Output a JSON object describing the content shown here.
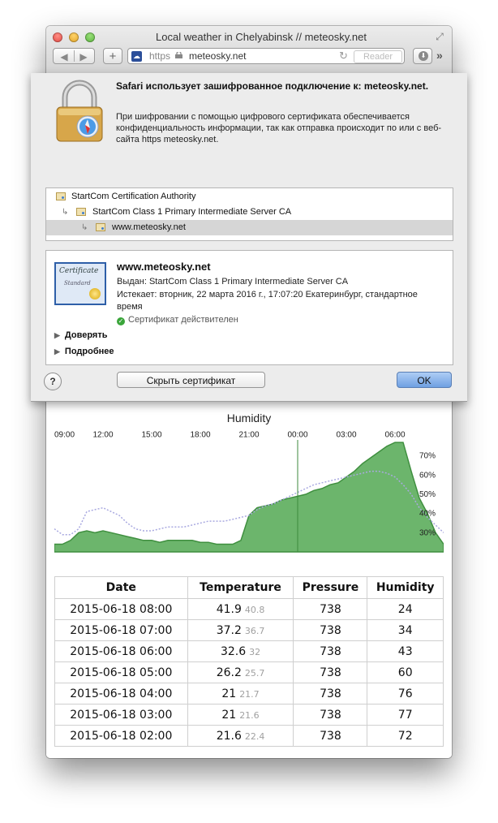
{
  "window": {
    "title": "Local weather in Chelyabinsk // meteosky.net"
  },
  "toolbar": {
    "back": "◀",
    "forward": "▶",
    "add": "+",
    "scheme": "https",
    "host": "meteosky.net",
    "reload": "↻",
    "reader": "Reader",
    "download": "⬇",
    "more": "»"
  },
  "sheet": {
    "heading": "Safari использует зашифрованное подключение к: meteosky.net.",
    "description": "При шифровании с помощью цифрового сертификата обеспечивается конфиденциальность информации, так как отправка происходит по или с веб-сайта https meteosky.net.",
    "chain": [
      {
        "label": "StartCom Certification Authority"
      },
      {
        "label": "StartCom Class 1 Primary Intermediate Server CA"
      },
      {
        "label": "www.meteosky.net"
      }
    ],
    "cert": {
      "name": "www.meteosky.net",
      "issued": "Выдан: StartCom Class 1 Primary Intermediate Server CA",
      "expires": "Истекает: вторник, 22 марта 2016 г., 17:07:20 Екатеринбург, стандартное время",
      "valid": "Сертификат действителен",
      "image_word1": "Certificate",
      "image_word2": "Standard"
    },
    "trust_label": "Доверять",
    "details_label": "Подробнее",
    "help": "?",
    "hide_button": "Скрыть сертификат",
    "ok_button": "OK"
  },
  "page": {
    "chart_title": "Humidity",
    "table": {
      "headers": [
        "Date",
        "Temperature",
        "Pressure",
        "Humidity"
      ],
      "rows": [
        {
          "date": "2015-06-18 08:00",
          "temp": "41.9",
          "temp2": "40.8",
          "pressure": "738",
          "humidity": "24"
        },
        {
          "date": "2015-06-18 07:00",
          "temp": "37.2",
          "temp2": "36.7",
          "pressure": "738",
          "humidity": "34"
        },
        {
          "date": "2015-06-18 06:00",
          "temp": "32.6",
          "temp2": "32",
          "pressure": "738",
          "humidity": "43"
        },
        {
          "date": "2015-06-18 05:00",
          "temp": "26.2",
          "temp2": "25.7",
          "pressure": "738",
          "humidity": "60"
        },
        {
          "date": "2015-06-18 04:00",
          "temp": "21",
          "temp2": "21.7",
          "pressure": "738",
          "humidity": "76"
        },
        {
          "date": "2015-06-18 03:00",
          "temp": "21",
          "temp2": "21.6",
          "pressure": "738",
          "humidity": "77"
        },
        {
          "date": "2015-06-18 02:00",
          "temp": "21.6",
          "temp2": "22.4",
          "pressure": "738",
          "humidity": "72"
        }
      ]
    }
  },
  "chart_data": {
    "type": "area",
    "title": "Humidity",
    "x_ticks": [
      "09:00",
      "12:00",
      "15:00",
      "18:00",
      "21:00",
      "00:00",
      "03:00",
      "06:00"
    ],
    "y_ticks": [
      "30%",
      "40%",
      "50%",
      "60%",
      "70%"
    ],
    "ylim": [
      20,
      80
    ],
    "marker_label": "00:00",
    "series": [
      {
        "color": "#6cb56c",
        "x": [
          0,
          0.5,
          1,
          1.5,
          2,
          2.5,
          3,
          3.5,
          4,
          4.5,
          5,
          5.5,
          6,
          6.5,
          7,
          7.5,
          8,
          8.5,
          9,
          9.5,
          10,
          10.5,
          11,
          11.5,
          12,
          12.5,
          13,
          13.5,
          14,
          14.5,
          15,
          15.5,
          16,
          16.5,
          17,
          17.5,
          18,
          18.5,
          19,
          19.5,
          20,
          20.5,
          21,
          21.5,
          22,
          22.5,
          23,
          23.5,
          24
        ],
        "values": [
          24,
          24,
          26,
          30,
          31,
          30,
          31,
          30,
          29,
          28,
          27,
          26,
          26,
          25,
          26,
          26,
          26,
          26,
          25,
          25,
          24,
          24,
          24,
          26,
          39,
          43,
          44,
          45,
          47,
          48,
          49,
          50,
          52,
          53,
          55,
          56,
          59,
          62,
          66,
          69,
          72,
          75,
          77,
          77,
          62,
          48,
          40,
          30,
          24
        ]
      },
      {
        "color": "#a9a9e0",
        "dashed": true,
        "x": [
          0,
          0.5,
          1,
          1.5,
          2,
          2.5,
          3,
          3.5,
          4,
          4.5,
          5,
          5.5,
          6,
          6.5,
          7,
          7.5,
          8,
          8.5,
          9,
          9.5,
          10,
          10.5,
          11,
          11.5,
          12,
          12.5,
          13,
          13.5,
          14,
          14.5,
          15,
          15.5,
          16,
          16.5,
          17,
          17.5,
          18,
          18.5,
          19,
          19.5,
          20,
          20.5,
          21,
          21.5,
          22,
          22.5,
          23,
          23.5,
          24
        ],
        "values": [
          32,
          29,
          29,
          32,
          41,
          42,
          43,
          41,
          39,
          35,
          32,
          31,
          31,
          32,
          33,
          33,
          33,
          34,
          35,
          36,
          36,
          36,
          37,
          38,
          39,
          42,
          44,
          45,
          47,
          49,
          51,
          53,
          55,
          56,
          57,
          58,
          59,
          60,
          61,
          62,
          62,
          61,
          59,
          55,
          50,
          43,
          38,
          34,
          30
        ]
      }
    ]
  }
}
